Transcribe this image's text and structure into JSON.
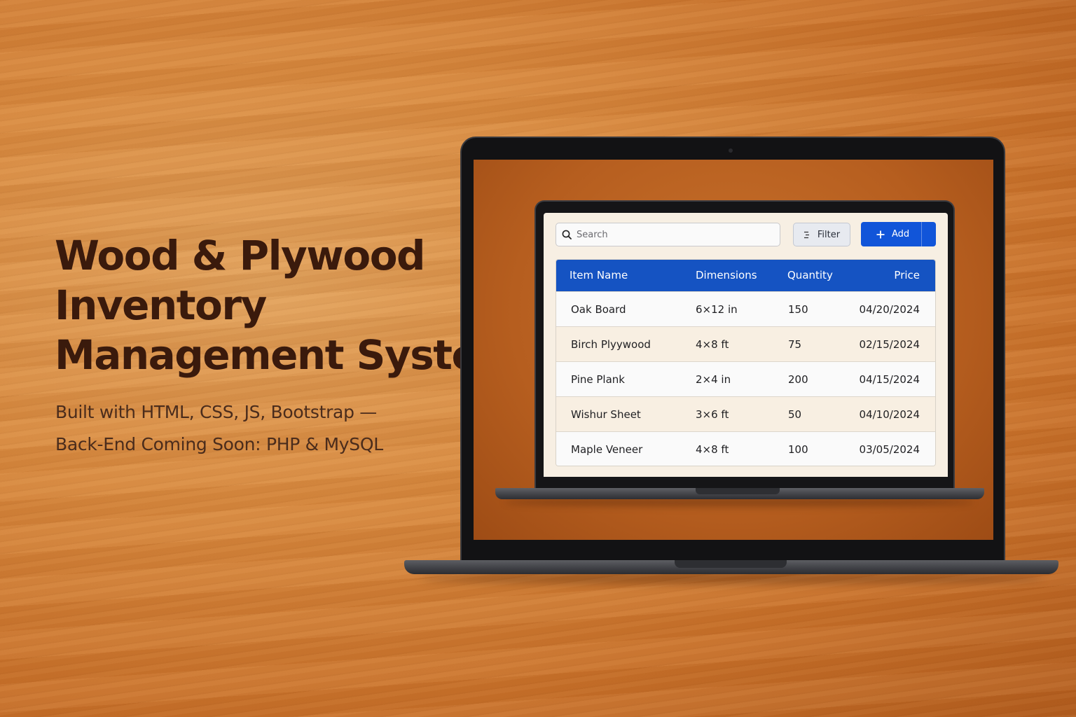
{
  "hero": {
    "title_lines": [
      "Wood & Plywood",
      "Inventory",
      "Management System"
    ],
    "subtitle_lines": [
      "Built with HTML, CSS, JS, Bootstrap —",
      "Back-End Coming Soon: PHP & MySQL"
    ]
  },
  "toolbar": {
    "search_placeholder": "Search",
    "filter_label": "Filter",
    "add_label": "Add"
  },
  "table": {
    "columns": [
      "Item Name",
      "Dimensions",
      "Quantity",
      "Price"
    ],
    "rows": [
      {
        "name": "Oak Board",
        "dimensions": "6×12 in",
        "quantity": "150",
        "price": "04/20/2024"
      },
      {
        "name": "Birch Plyywood",
        "dimensions": "4×8 ft",
        "quantity": "75",
        "price": "02/15/2024"
      },
      {
        "name": "Pine Plank",
        "dimensions": "2×4 in",
        "quantity": "200",
        "price": "04/15/2024"
      },
      {
        "name": "Wishur Sheet",
        "dimensions": "3×6 ft",
        "quantity": "50",
        "price": "04/10/2024"
      },
      {
        "name": "Maple Veneer",
        "dimensions": "4×8 ft",
        "quantity": "100",
        "price": "03/05/2024"
      }
    ]
  },
  "colors": {
    "accent": "#1155d9",
    "header": "#1553c2",
    "title_text": "#3a1a0c",
    "wood": "#d98a3f"
  },
  "icons": [
    "search-icon",
    "filter-icon",
    "plus-icon"
  ]
}
